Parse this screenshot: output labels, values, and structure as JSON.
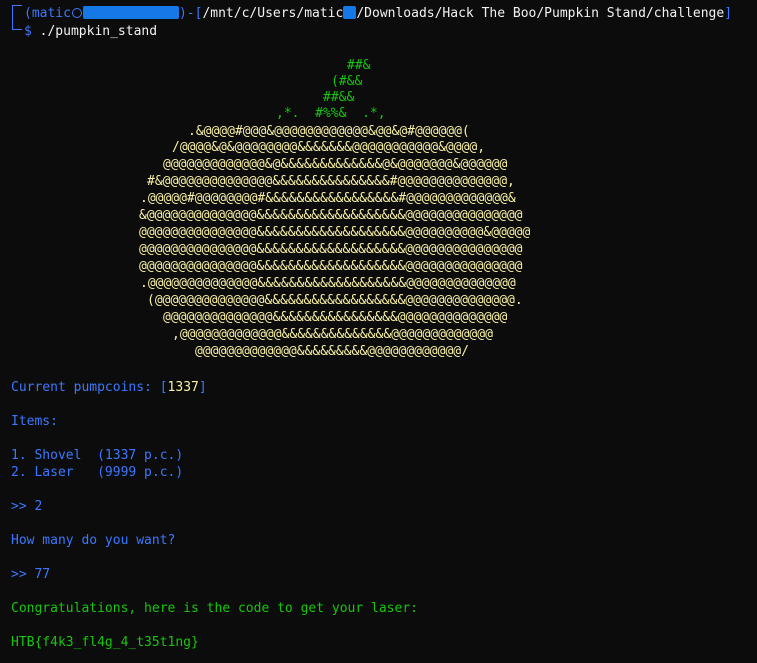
{
  "prompt": {
    "user_prefix": "(matic",
    "close_paren": ")-[",
    "path_part1": "/mnt/c/Users/matic",
    "path_part2": "/Downloads/Hack The Boo/Pumpkin Stand/challenge",
    "path_close": "]",
    "dollar": "$",
    "command": "./pumpkin_stand"
  },
  "art": {
    "stem": [
      "##&",
      "(#&&",
      "##&&",
      ",*.  #%%&  .*,"
    ],
    "body": [
      ".&@@@@#@@@&@@@@@@@@@@@@&@@&@#@@@@@@(",
      "/@@@@&@&@@@@@@@@&&&&&&&@@@@@@@@@@@&@@@@,",
      "@@@@@@@@@@@@@&@&&&&&&&&&&&&&@&@@@@@@@&@@@@@@",
      "#&@@@@@@@@@@@@@@&&&&&&&&&&&&&&&#@@@@@@@@@@@@@@,",
      ".@@@@@#@@@@@@@@#&&&&&&&&&&&&&&&&&#@@@@@@@@@@@@@&",
      "&@@@@@@@@@@@@@@&&&&&&&&&&&&&&&&&&&@@@@@@@@@@@@@@@",
      "@@@@@@@@@@@@@@@&&&&&&&&&&&&&&&&&&&@@@@@@@@@@&@@@@@",
      "@@@@@@@@@@@@@@@&&&&&&&&&&&&&&&&&&&@@@@@@@@@@@@@@@",
      "@@@@@@@@@@@@@@@&&&&&&&&&&&&&&&&&&&@@@@@@@@@@@@@@@",
      ".@@@@@@@@@@@@@@&&&&&&&&&&&&&&&&&&&@@@@@@@@@@@@@@",
      "(@@@@@@@@@@@@@@&&&&&&&&&&&&&&&&&&@@@@@@@@@@@@@@.",
      "@@@@@@@@@@@@@@&&&&&&&&&&&&&&&&@@@@@@@@@@@@@@",
      ",@@@@@@@@@@@@@&&&&&&&&&&&&&&@@@@@@@@@@@@@",
      "@@@@@@@@@@@@@&&&&&&&&&@@@@@@@@@@@@/"
    ]
  },
  "output": {
    "coins_label": "Current pumpcoins: ",
    "coins_open": "[",
    "coins_value": "1337",
    "coins_close": "]",
    "items_label": "Items:",
    "item1": "1. Shovel  (1337 p.c.)",
    "item2": "2. Laser   (9999 p.c.)",
    "choice_prompt": ">> 2",
    "qty_question": "How many do you want?",
    "qty_prompt": ">> 77",
    "congrats": "Congratulations, here is the code to get your laser:",
    "flag": "HTB{f4k3_fl4g_4_t35t1ng}"
  }
}
